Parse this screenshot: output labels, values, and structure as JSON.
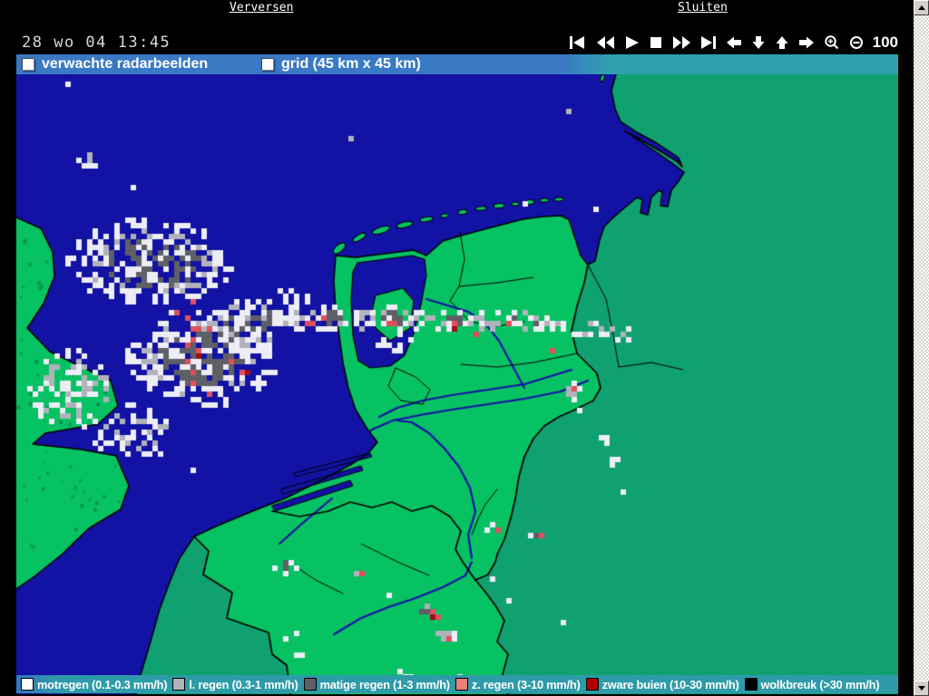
{
  "header": {
    "refresh_label": "Verversen",
    "close_label": "Sluiten"
  },
  "toolbar": {
    "timestamp": "28 wo 04 13:45",
    "zoom_value": "100",
    "icons": [
      "skip-to-start",
      "rewind",
      "play",
      "stop",
      "fast-forward",
      "skip-to-end",
      "pan-left",
      "pan-down",
      "pan-up",
      "pan-right",
      "zoom-in",
      "zoom-out"
    ]
  },
  "options": {
    "radar_label": "verwachte radarbeelden",
    "radar_checked": false,
    "grid_label": "grid (45 km x 45 km)",
    "grid_checked": false
  },
  "legend": {
    "items": [
      {
        "label": "motregen (0.1-0.3 mm/h)",
        "color": "#ffffff"
      },
      {
        "label": "l. regen (0.3-1 mm/h)",
        "color": "#b2b2bc"
      },
      {
        "label": "matige regen (1-3 mm/h)",
        "color": "#5f5f67"
      },
      {
        "label": "z. regen (3-10 mm/h)",
        "color": "#f07f78"
      },
      {
        "label": "zware buien (10-30 mm/h)",
        "color": "#b00000"
      },
      {
        "label": "wolkbreuk (>30 mm/h)",
        "color": "#000000"
      }
    ]
  },
  "map": {
    "colors": {
      "sea": "#1212a4",
      "land_bright": "#07c263",
      "land_muted": "#10a171",
      "speckle": "#0a7a48",
      "border": "#000000",
      "precip_white": "#ededf6",
      "precip_light": "#b2b2bc",
      "precip_dark": "#5f5f67",
      "precip_red": "#e14f5c",
      "precip_darkred": "#990f13",
      "bar_blue": "#3a79c4",
      "bar_teal": "#2f9fae",
      "legend_teal": "#2e9ba8"
    }
  }
}
